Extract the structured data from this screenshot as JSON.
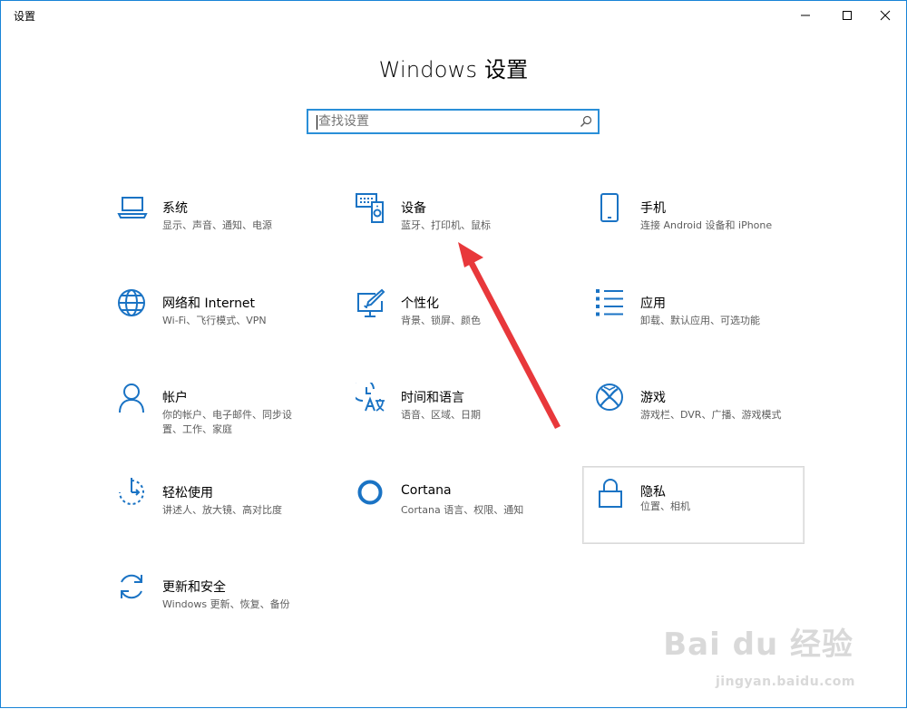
{
  "window": {
    "title": "设置"
  },
  "heading": "Windows 设置",
  "search": {
    "placeholder": "查找设置"
  },
  "tiles": [
    {
      "name": "系统",
      "desc": "显示、声音、通知、电源",
      "icon": "laptop-icon"
    },
    {
      "name": "设备",
      "desc": "蓝牙、打印机、鼠标",
      "icon": "devices-icon"
    },
    {
      "name": "手机",
      "desc": "连接 Android 设备和 iPhone",
      "icon": "phone-icon"
    },
    {
      "name": "网络和 Internet",
      "desc": "Wi-Fi、飞行模式、VPN",
      "icon": "globe-icon"
    },
    {
      "name": "个性化",
      "desc": "背景、锁屏、颜色",
      "icon": "personalization-icon"
    },
    {
      "name": "应用",
      "desc": "卸载、默认应用、可选功能",
      "icon": "apps-list-icon"
    },
    {
      "name": "帐户",
      "desc": "你的帐户、电子邮件、同步设置、工作、家庭",
      "icon": "person-icon"
    },
    {
      "name": "时间和语言",
      "desc": "语音、区域、日期",
      "icon": "time-language-icon"
    },
    {
      "name": "游戏",
      "desc": "游戏栏、DVR、广播、游戏模式",
      "icon": "xbox-icon"
    },
    {
      "name": "轻松使用",
      "desc": "讲述人、放大镜、高对比度",
      "icon": "ease-of-access-icon"
    },
    {
      "name": "Cortana",
      "desc": "Cortana 语言、权限、通知",
      "icon": "cortana-icon"
    },
    {
      "name": "隐私",
      "desc": "位置、相机",
      "icon": "lock-icon"
    },
    {
      "name": "更新和安全",
      "desc": "Windows 更新、恢复、备份",
      "icon": "update-icon"
    }
  ],
  "watermark": {
    "brand": "Bai du 经验",
    "url": "jingyan.baidu.com"
  },
  "colors": {
    "accent": "#0f6cbd",
    "icon": "#1a73c4",
    "arrow": "#e8383b"
  }
}
